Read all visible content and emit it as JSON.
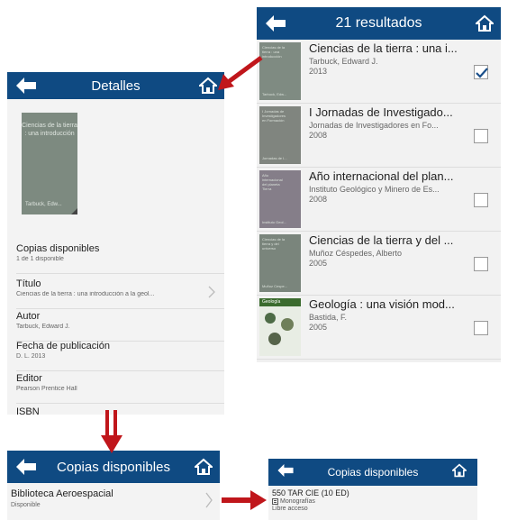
{
  "results": {
    "header_title": "21 resultados",
    "items": [
      {
        "title": "Ciencias de la tierra : una i...",
        "author": "Tarbuck, Edward J.",
        "year": "2013",
        "checked": true,
        "thumb_lines": [
          "Ciencias de la",
          "tierra : una",
          "introducción"
        ],
        "thumb_footer": "Tarbuck, Edw..."
      },
      {
        "title": "I Jornadas de Investigado...",
        "author": "Jornadas de Investigadores en Fo...",
        "year": "2008",
        "checked": false,
        "thumb_lines": [
          "I Jornadas de",
          "Investigadores",
          "en Formación"
        ],
        "thumb_footer": "Jornadas de I..."
      },
      {
        "title": "Año internacional del plan...",
        "author": "Instituto Geológico y Minero de Es...",
        "year": "2008",
        "checked": false,
        "thumb_lines": [
          "Año",
          "internacional",
          "del planeta",
          "Tierra"
        ],
        "thumb_footer": "Instituto Geol..."
      },
      {
        "title": "Ciencias de la tierra y del ...",
        "author": "Muñoz Céspedes, Alberto",
        "year": "2005",
        "checked": false,
        "thumb_lines": [
          "Ciencias de la",
          "tierra y del",
          "universo"
        ],
        "thumb_footer": "Muñoz Cespe..."
      },
      {
        "title": "Geología : una visión mod...",
        "author": "Bastida, F.",
        "year": "2005",
        "checked": false,
        "thumb_lines": [
          "Geología"
        ],
        "thumb_footer": ""
      }
    ]
  },
  "details": {
    "header_title": "Detalles",
    "cover_title": "Ciencias de la tierra : una introducción",
    "cover_author": "Tarbuck, Edw...",
    "fields": [
      {
        "label": "Copias disponibles",
        "value": "1 de 1 disponible"
      },
      {
        "label": "Título",
        "value": "Ciencias de la tierra : una introducción a la geol..."
      },
      {
        "label": "Autor",
        "value": "Tarbuck, Edward J."
      },
      {
        "label": "Fecha de publicación",
        "value": "D. L. 2013"
      },
      {
        "label": "Editor",
        "value": "Pearson Prentice Hall"
      },
      {
        "label": "ISBN",
        "value": ""
      }
    ]
  },
  "copias_left": {
    "header_title": "Copias disponibles",
    "library": "Biblioteca Aeroespacial",
    "status": "Disponible"
  },
  "copias_right": {
    "header_title": "Copias disponibles",
    "callnumber": "550 TAR CIE (10 ED)",
    "type": "Monografías",
    "access": "Libre acceso"
  },
  "colors": {
    "header": "#0f4a82",
    "arrow": "#c0161b",
    "check": "#1a4f8a"
  }
}
